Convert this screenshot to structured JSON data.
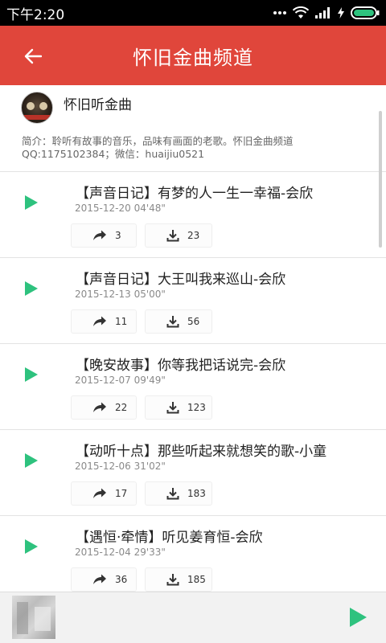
{
  "status_bar": {
    "time": "下午2:20"
  },
  "header": {
    "title": "怀旧金曲频道"
  },
  "channel": {
    "name": "怀旧听金曲",
    "description": "简介：聆听有故事的音乐，品味有画面的老歌。怀旧金曲频道QQ:1175102384；微信：huaijiu0521"
  },
  "tracks": [
    {
      "title": "【声音日记】有梦的人一生一幸福-会欣",
      "date": "2015-12-20",
      "duration": "04'48\"",
      "shares": "3",
      "downloads": "23"
    },
    {
      "title": "【声音日记】大王叫我来巡山-会欣",
      "date": "2015-12-13",
      "duration": "05'00\"",
      "shares": "11",
      "downloads": "56"
    },
    {
      "title": "【晚安故事】你等我把话说完-会欣",
      "date": "2015-12-07",
      "duration": "09'49\"",
      "shares": "22",
      "downloads": "123"
    },
    {
      "title": "【动听十点】那些听起来就想笑的歌-小童",
      "date": "2015-12-06",
      "duration": "31'02\"",
      "shares": "17",
      "downloads": "183"
    },
    {
      "title": "【遇恒·牵情】听见姜育恒-会欣",
      "date": "2015-12-04",
      "duration": "29'33\"",
      "shares": "36",
      "downloads": "185"
    }
  ],
  "colors": {
    "accent": "#e0463b",
    "play": "#2ec27e"
  }
}
